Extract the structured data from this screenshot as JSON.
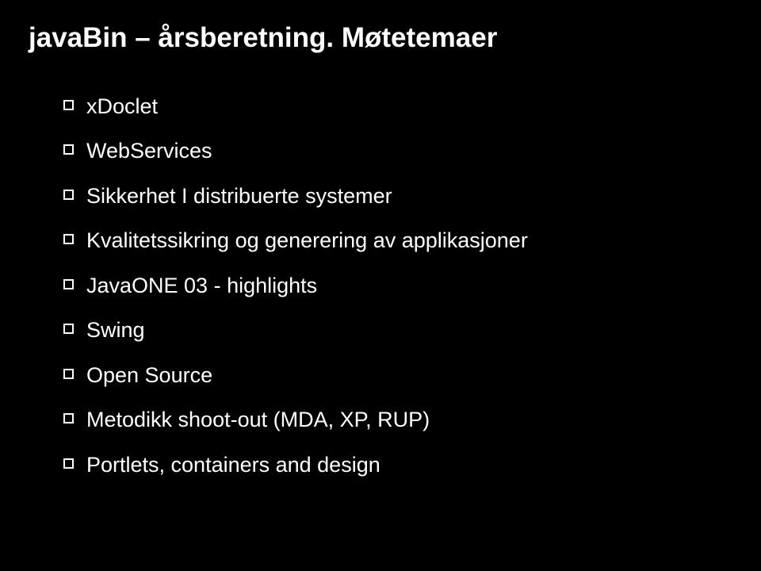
{
  "slide": {
    "title": "javaBin – årsberetning. Møtetemaer",
    "bullets": [
      "xDoclet",
      "WebServices",
      "Sikkerhet I distribuerte systemer",
      "Kvalitetssikring og generering av applikasjoner",
      "JavaONE 03 - highlights",
      "Swing",
      "Open Source",
      "Metodikk shoot-out (MDA, XP, RUP)",
      "Portlets, containers and design"
    ]
  }
}
